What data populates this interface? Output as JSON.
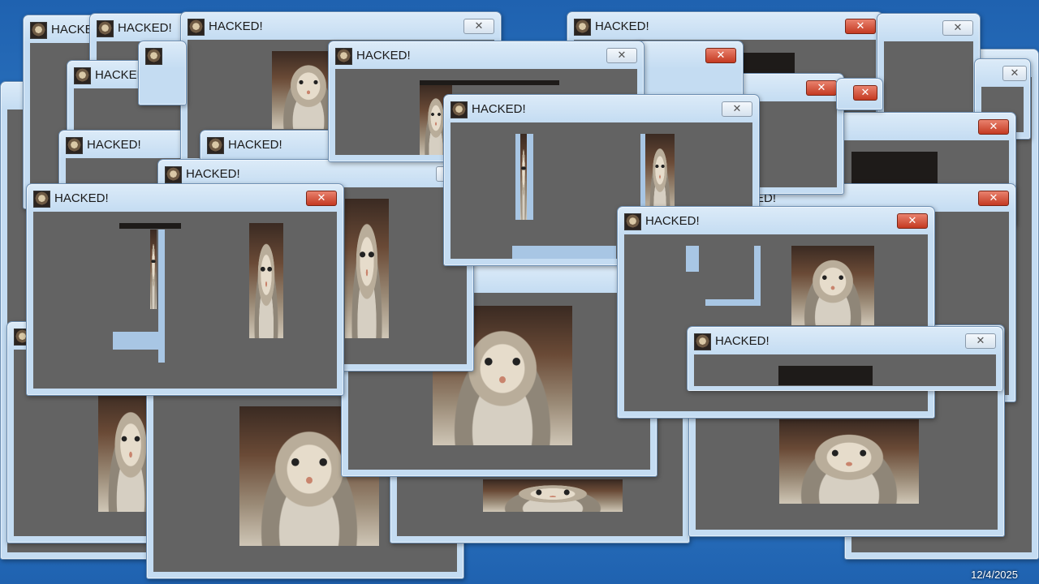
{
  "window_title": "HACKED!",
  "taskbar": {
    "date": "12/4/2025"
  },
  "icons": {
    "app_icon": "cat-face-icon",
    "close_icon": "close-icon"
  },
  "colors": {
    "client_bg": "#636363",
    "close_red": "#c43a22",
    "title_bg": "#c4dcf2"
  }
}
